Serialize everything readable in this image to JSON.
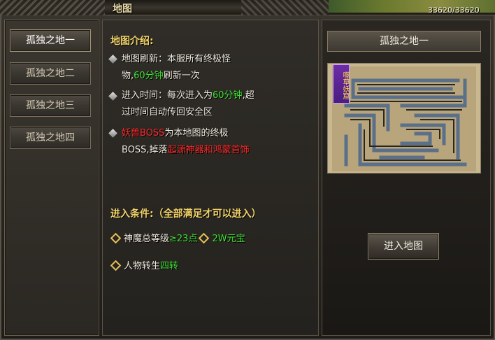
{
  "window": {
    "title": "地图",
    "hp_readout": "33620/33620"
  },
  "nav": {
    "items": [
      {
        "label": "孤独之地一",
        "active": true
      },
      {
        "label": "孤独之地二",
        "active": false
      },
      {
        "label": "孤独之地三",
        "active": false
      },
      {
        "label": "孤独之地四",
        "active": false
      }
    ]
  },
  "intro": {
    "title": "地图介绍:",
    "refresh": {
      "a": "地图刷新：本服所有终极怪",
      "b": "物,",
      "time": "60分钟",
      "c": "刷新一次"
    },
    "entry": {
      "a": "进入时间：每次进入为",
      "time": "60分钟",
      "b": ",超",
      "c": "过时间自动传回安全区"
    },
    "boss": {
      "name": "妖兽BOSS",
      "a": "为本地图的终极",
      "b": "BOSS,掉落",
      "drops": "起源神器和鸿蒙首饰"
    }
  },
  "conditions": {
    "title": "进入条件:（全部满足才可以进入）",
    "row1": {
      "a": "神魔总等级",
      "level": "≥23点",
      "gold": "2W元宝"
    },
    "row2": {
      "a": "人物转生",
      "rebirth": "四转"
    }
  },
  "preview": {
    "name": "孤独之地一",
    "map_badge": "噬草妖窟",
    "enter_label": "进入地图"
  },
  "colors": {
    "accent_yellow": "#f2d36a",
    "green": "#3fe035",
    "red": "#ff2a2a"
  }
}
